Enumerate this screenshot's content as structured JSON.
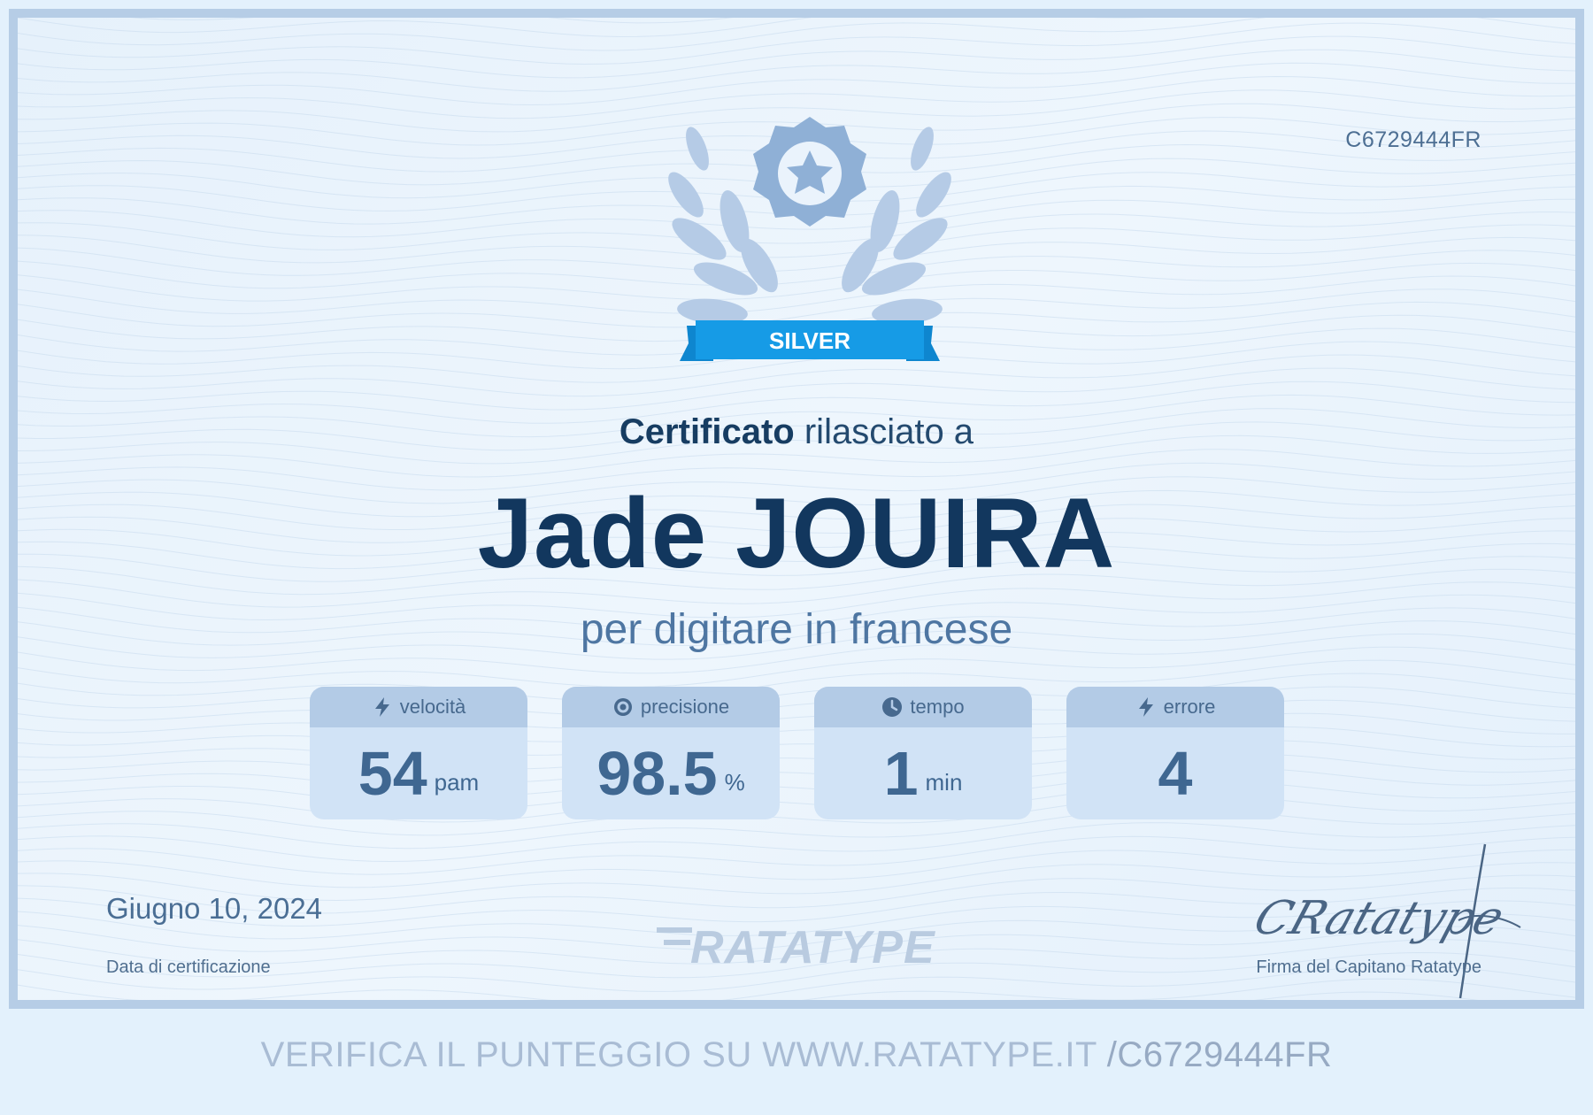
{
  "certificate": {
    "id": "C6729444FR",
    "level": "SILVER",
    "heading_bold": "Certificato",
    "heading_rest": "rilasciato a",
    "name": "Jade JOUIRA",
    "subtitle": "per digitare in francese"
  },
  "stats": [
    {
      "label": "velocità",
      "value": "54",
      "unit": "pam",
      "icon": "lightning-icon"
    },
    {
      "label": "precisione",
      "value": "98.5",
      "unit": "%",
      "icon": "target-icon"
    },
    {
      "label": "tempo",
      "value": "1",
      "unit": "min",
      "icon": "clock-icon"
    },
    {
      "label": "errore",
      "value": "4",
      "unit": "",
      "icon": "lightning-icon"
    }
  ],
  "footer": {
    "date": "Giugno 10, 2024",
    "date_label": "Data di certificazione",
    "logo_text": "RATATYPE",
    "signature_text": "CRatatype",
    "signature_label": "Firma del Capitano Ratatype"
  },
  "verify": {
    "text": "VERIFICA IL PUNTEGGIO SU WWW.RATATYPE.IT",
    "code": "/C6729444FR"
  },
  "colors": {
    "background": "#e3f1fc",
    "border": "#b6cde6",
    "name": "#12375e",
    "badge": "#169be6",
    "emblem": "#8fb0d6"
  }
}
